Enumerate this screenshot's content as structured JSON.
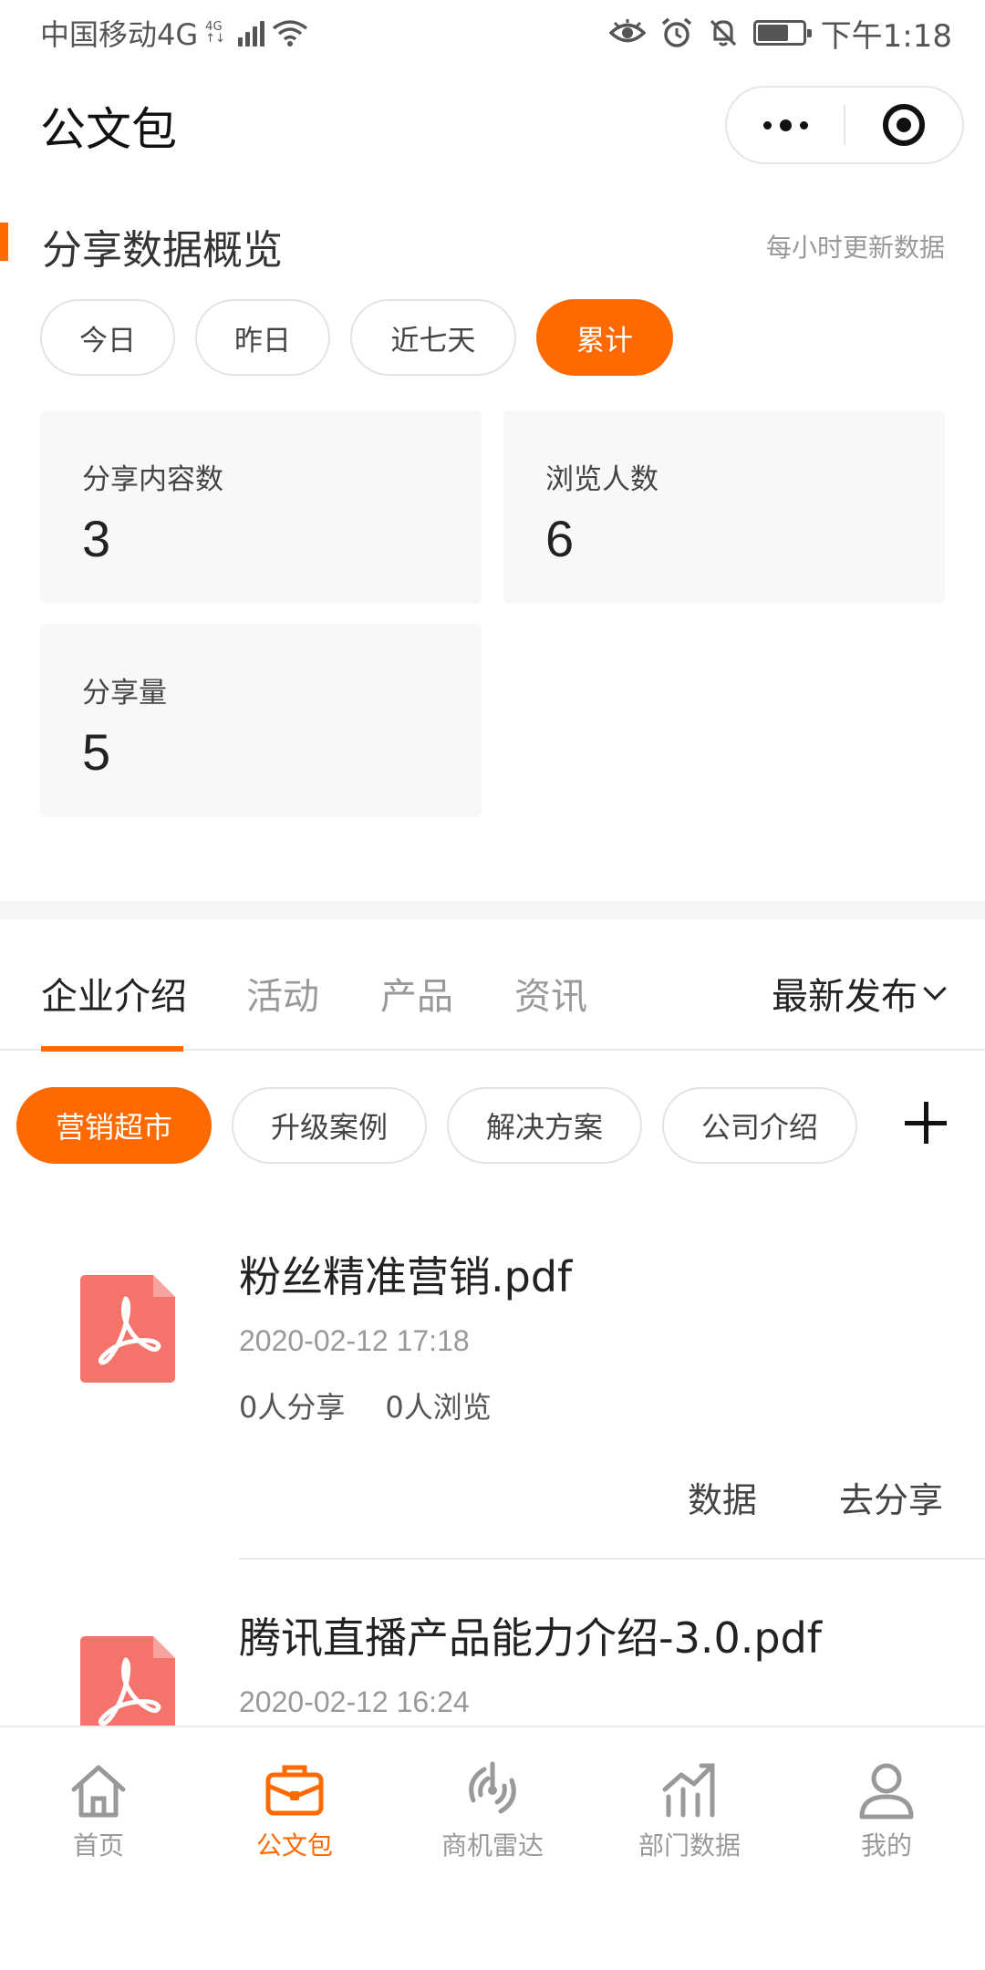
{
  "status_bar": {
    "carrier": "中国移动4G",
    "net_top": "4G",
    "net_bottom": "↑↓",
    "time": "下午1:18"
  },
  "nav": {
    "title": "公文包"
  },
  "overview": {
    "title": "分享数据概览",
    "note": "每小时更新数据",
    "periods": [
      "今日",
      "昨日",
      "近七天",
      "累计"
    ],
    "active_period": "累计",
    "stats": [
      {
        "label": "分享内容数",
        "value": "3"
      },
      {
        "label": "浏览人数",
        "value": "6"
      },
      {
        "label": "分享量",
        "value": "5"
      }
    ]
  },
  "category_tabs": {
    "items": [
      "企业介绍",
      "活动",
      "产品",
      "资讯"
    ],
    "active": "企业介绍",
    "sort_label": "最新发布"
  },
  "chips": {
    "items": [
      "营销超市",
      "升级案例",
      "解决方案",
      "公司介绍"
    ],
    "active": "营销超市"
  },
  "documents": [
    {
      "title": "粉丝精准营销.pdf",
      "time": "2020-02-12 17:18",
      "shares": "0人分享",
      "views": "0人浏览",
      "action_data": "数据",
      "action_share": "去分享"
    },
    {
      "title": "腾讯直播产品能力介绍-3.0.pdf",
      "time": "2020-02-12 16:24"
    }
  ],
  "tabbar": {
    "items": [
      "首页",
      "公文包",
      "商机雷达",
      "部门数据",
      "我的"
    ],
    "active": "公文包"
  },
  "colors": {
    "accent": "#ff6a00",
    "pdf": "#f4736a"
  }
}
